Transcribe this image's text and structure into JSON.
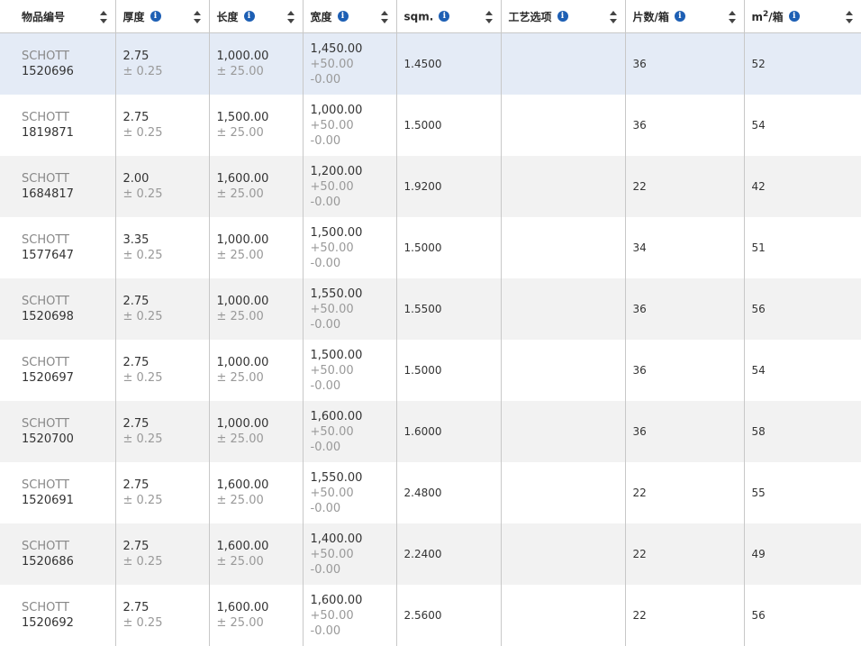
{
  "headers": [
    {
      "label": "物品编号",
      "info": false
    },
    {
      "label": "厚度",
      "info": true
    },
    {
      "label": "长度",
      "info": true
    },
    {
      "label": "宽度",
      "info": true
    },
    {
      "label": "sqm.",
      "info": true
    },
    {
      "label": "工艺选项",
      "info": true
    },
    {
      "label": "片数/箱",
      "info": true
    },
    {
      "label": "m",
      "sup": "2",
      "suffix": "/箱",
      "info": true
    }
  ],
  "icons": {
    "info": "info-icon",
    "sort": "sort-icon"
  },
  "colors": {
    "info_icon": "#1d5fb4",
    "selected_row": "#e4ebf6",
    "striped_row": "#f2f2f2"
  },
  "rows": [
    {
      "brand": "SCHOTT",
      "id": "1520696",
      "thickness": "2.75",
      "thickness_tol": "± 0.25",
      "length": "1,000.00",
      "length_tol": "± 25.00",
      "width": "1,450.00",
      "width_tol_plus": "+50.00",
      "width_tol_minus": "-0.00",
      "sqm": "1.4500",
      "process": "",
      "pieces": "36",
      "m2": "52",
      "selected": true
    },
    {
      "brand": "SCHOTT",
      "id": "1819871",
      "thickness": "2.75",
      "thickness_tol": "± 0.25",
      "length": "1,500.00",
      "length_tol": "± 25.00",
      "width": "1,000.00",
      "width_tol_plus": "+50.00",
      "width_tol_minus": "-0.00",
      "sqm": "1.5000",
      "process": "",
      "pieces": "36",
      "m2": "54"
    },
    {
      "brand": "SCHOTT",
      "id": "1684817",
      "thickness": "2.00",
      "thickness_tol": "± 0.25",
      "length": "1,600.00",
      "length_tol": "± 25.00",
      "width": "1,200.00",
      "width_tol_plus": "+50.00",
      "width_tol_minus": "-0.00",
      "sqm": "1.9200",
      "process": "",
      "pieces": "22",
      "m2": "42"
    },
    {
      "brand": "SCHOTT",
      "id": "1577647",
      "thickness": "3.35",
      "thickness_tol": "± 0.25",
      "length": "1,000.00",
      "length_tol": "± 25.00",
      "width": "1,500.00",
      "width_tol_plus": "+50.00",
      "width_tol_minus": "-0.00",
      "sqm": "1.5000",
      "process": "",
      "pieces": "34",
      "m2": "51"
    },
    {
      "brand": "SCHOTT",
      "id": "1520698",
      "thickness": "2.75",
      "thickness_tol": "± 0.25",
      "length": "1,000.00",
      "length_tol": "± 25.00",
      "width": "1,550.00",
      "width_tol_plus": "+50.00",
      "width_tol_minus": "-0.00",
      "sqm": "1.5500",
      "process": "",
      "pieces": "36",
      "m2": "56"
    },
    {
      "brand": "SCHOTT",
      "id": "1520697",
      "thickness": "2.75",
      "thickness_tol": "± 0.25",
      "length": "1,000.00",
      "length_tol": "± 25.00",
      "width": "1,500.00",
      "width_tol_plus": "+50.00",
      "width_tol_minus": "-0.00",
      "sqm": "1.5000",
      "process": "",
      "pieces": "36",
      "m2": "54"
    },
    {
      "brand": "SCHOTT",
      "id": "1520700",
      "thickness": "2.75",
      "thickness_tol": "± 0.25",
      "length": "1,000.00",
      "length_tol": "± 25.00",
      "width": "1,600.00",
      "width_tol_plus": "+50.00",
      "width_tol_minus": "-0.00",
      "sqm": "1.6000",
      "process": "",
      "pieces": "36",
      "m2": "58"
    },
    {
      "brand": "SCHOTT",
      "id": "1520691",
      "thickness": "2.75",
      "thickness_tol": "± 0.25",
      "length": "1,600.00",
      "length_tol": "± 25.00",
      "width": "1,550.00",
      "width_tol_plus": "+50.00",
      "width_tol_minus": "-0.00",
      "sqm": "2.4800",
      "process": "",
      "pieces": "22",
      "m2": "55"
    },
    {
      "brand": "SCHOTT",
      "id": "1520686",
      "thickness": "2.75",
      "thickness_tol": "± 0.25",
      "length": "1,600.00",
      "length_tol": "± 25.00",
      "width": "1,400.00",
      "width_tol_plus": "+50.00",
      "width_tol_minus": "-0.00",
      "sqm": "2.2400",
      "process": "",
      "pieces": "22",
      "m2": "49"
    },
    {
      "brand": "SCHOTT",
      "id": "1520692",
      "thickness": "2.75",
      "thickness_tol": "± 0.25",
      "length": "1,600.00",
      "length_tol": "± 25.00",
      "width": "1,600.00",
      "width_tol_plus": "+50.00",
      "width_tol_minus": "-0.00",
      "sqm": "2.5600",
      "process": "",
      "pieces": "22",
      "m2": "56"
    }
  ]
}
